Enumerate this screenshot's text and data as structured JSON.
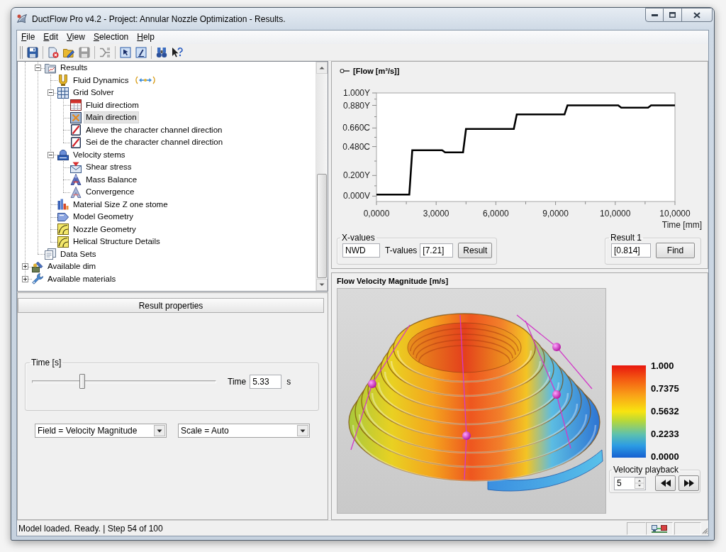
{
  "window": {
    "title": "DuctFlow Pro v4.2 - Project: Annular Nozzle Optimization - Results."
  },
  "menu": [
    "File",
    "Edit",
    "View",
    "Selection",
    "Help"
  ],
  "toolbar": {
    "groups": [
      [
        {
          "disabled": false
        }
      ],
      [
        {
          "disabled": false
        },
        {
          "disabled": false
        },
        {
          "disabled": true
        }
      ],
      [
        {
          "disabled": true
        }
      ],
      [
        {
          "disabled": false
        },
        {
          "disabled": false
        }
      ],
      [
        {
          "disabled": false
        },
        {
          "disabled": false
        }
      ]
    ]
  },
  "tree": {
    "items": [
      {
        "children": [
          {
            "label": "Results",
            "expanded": true,
            "selected": false,
            "children": [
              {
                "label": "Fluid Dynamics",
                "selected": false
              },
              {
                "label": "Grid Solver",
                "expanded": true,
                "selected": false,
                "children": [
                  {
                    "label": "Fluid directiom",
                    "selected": false
                  },
                  {
                    "label": "Main direction",
                    "selected": true
                  },
                  {
                    "label": "Alıeve the character channel direction",
                    "selected": false
                  },
                  {
                    "label": "Sei de the character channel direction",
                    "selected": false
                  }
                ]
              },
              {
                "label": "Velocity stems",
                "expanded": true,
                "selected": false,
                "children": [
                  {
                    "label": "Shear stress",
                    "selected": false
                  },
                  {
                    "label": "Mass Balance",
                    "selected": false
                  },
                  {
                    "label": "Convergence",
                    "selected": false
                  }
                ]
              },
              {
                "label": "Material Size Z one stome",
                "selected": false
              },
              {
                "label": "Model Geometry",
                "selected": false
              },
              {
                "label": "Nozzle Geometry",
                "selected": false
              },
              {
                "label": "Helical Structure Details",
                "selected": false
              }
            ]
          },
          {
            "label": "Data Sets",
            "selected": false
          }
        ]
      },
      {
        "label": "Available dim",
        "expanded": false,
        "selected": false
      },
      {
        "label": "Available materials",
        "expanded": false,
        "selected": false
      }
    ]
  },
  "result_properties": {
    "header": "Result properties",
    "time_group": {
      "legend": "Time [s]",
      "slider": {
        "level": 0.27
      },
      "label": "Time",
      "value": "5.33",
      "unit": "s"
    },
    "dropdowns": [
      {
        "value": "Field = Velocity Magnitude"
      },
      {
        "value": "Scale = Auto"
      }
    ]
  },
  "flow_chart": {
    "chart_data": {
      "type": "line",
      "title": "[Flow [m³/s]]",
      "xlabel": "Time [mm]",
      "categories": [
        "0,0000",
        null,
        null,
        null,
        null,
        null,
        null,
        null,
        null,
        null,
        null,
        null,
        null,
        null,
        null,
        null,
        null,
        null,
        null,
        null,
        "3,0000",
        null,
        null,
        null,
        null,
        null,
        null,
        null,
        null,
        null,
        null,
        null,
        null,
        null,
        null,
        null,
        null,
        null,
        null,
        null,
        "6,0000",
        null,
        null,
        null,
        null,
        null,
        null,
        null,
        null,
        null,
        null,
        null,
        null,
        null,
        null,
        null,
        null,
        null,
        null,
        null,
        "9,0000",
        null,
        null,
        null,
        null,
        null,
        null,
        null,
        null,
        null,
        null,
        null,
        null,
        null,
        null,
        null,
        null,
        null,
        null,
        null,
        "10,0000",
        null,
        null,
        null,
        null,
        null,
        null,
        null,
        null,
        null,
        null,
        null,
        null,
        null,
        null,
        null,
        null,
        null,
        null,
        null,
        "10,0000"
      ],
      "values": [
        0.015,
        0.015,
        0.015,
        0.015,
        0.015,
        0.015,
        0.015,
        0.015,
        0.015,
        0.015,
        0.015,
        0.015,
        0.445,
        0.445,
        0.445,
        0.445,
        0.445,
        0.445,
        0.445,
        0.445,
        0.445,
        0.445,
        0.445,
        0.424,
        0.424,
        0.424,
        0.424,
        0.424,
        0.424,
        0.424,
        0.651,
        0.651,
        0.651,
        0.651,
        0.651,
        0.651,
        0.651,
        0.651,
        0.651,
        0.651,
        0.651,
        0.651,
        0.651,
        0.651,
        0.651,
        0.651,
        0.651,
        0.792,
        0.792,
        0.792,
        0.792,
        0.792,
        0.792,
        0.792,
        0.792,
        0.792,
        0.792,
        0.792,
        0.792,
        0.792,
        0.792,
        0.792,
        0.792,
        0.792,
        0.88,
        0.88,
        0.88,
        0.88,
        0.88,
        0.88,
        0.88,
        0.88,
        0.88,
        0.88,
        0.88,
        0.88,
        0.88,
        0.88,
        0.88,
        0.88,
        0.88,
        0.88,
        0.858,
        0.858,
        0.858,
        0.858,
        0.858,
        0.858,
        0.858,
        0.858,
        0.858,
        0.858,
        0.88,
        0.88,
        0.88,
        0.88,
        0.88,
        0.88,
        0.88,
        0.88,
        0.88
      ],
      "ylim": [
        -0.052,
        1
      ],
      "yticks": [
        {
          "value": 0,
          "label": "0.000V"
        },
        {
          "value": 0.2,
          "label": "0.200Y"
        },
        {
          "value": 0.48,
          "label": "0.480C"
        },
        {
          "value": 0.66,
          "label": "0.660C"
        },
        {
          "value": 0.88,
          "label": "0.880Y"
        },
        {
          "value": 1,
          "label": "1.000Y"
        }
      ]
    },
    "x_values": {
      "legend": "X-values",
      "value": "NWD",
      "t_label": "T-values",
      "t_value": "[7.21]",
      "button": "Result"
    },
    "result_group": {
      "legend": "Result 1",
      "value": "[0.814]",
      "button": "Find"
    }
  },
  "velocity_view": {
    "title": "Flow Velocity Magnitude [m/s]",
    "legend_labels": [
      "1.000",
      "0.7375",
      "0.5632",
      "0.2233",
      "0.0000"
    ],
    "playback": {
      "legend": "Velocity playback",
      "value": "5"
    }
  },
  "status_bar": {
    "text": "Model loaded. Ready. | Step 54 of 100"
  }
}
